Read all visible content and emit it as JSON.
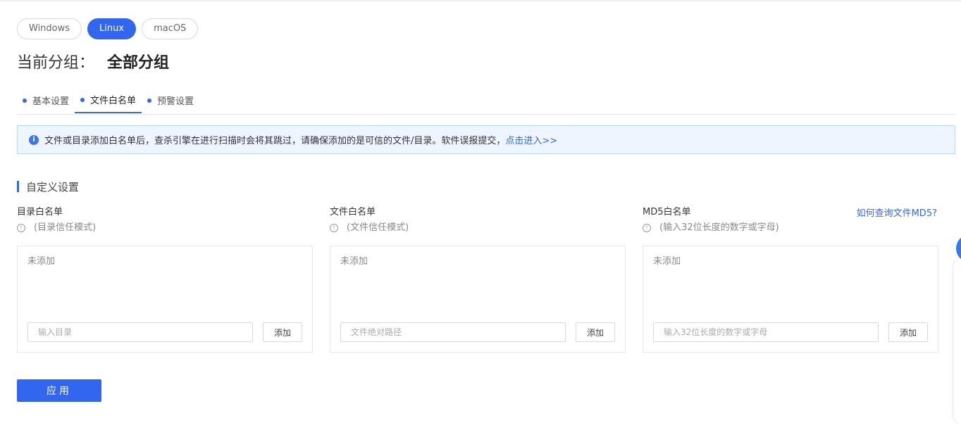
{
  "os_tabs": [
    {
      "label": "Windows",
      "active": false
    },
    {
      "label": "Linux",
      "active": true
    },
    {
      "label": "macOS",
      "active": false
    }
  ],
  "group": {
    "label": "当前分组：",
    "value": "全部分组"
  },
  "sub_tabs": [
    {
      "label": "基本设置",
      "active": false
    },
    {
      "label": "文件白名单",
      "active": true
    },
    {
      "label": "预警设置",
      "active": false
    }
  ],
  "notice": {
    "text": "文件或目录添加白名单后，查杀引擎在进行扫描时会将其跳过，请确保添加的是可信的文件/目录。软件误报提交，",
    "link": "点击进入>>"
  },
  "section": {
    "title": "自定义设置"
  },
  "columns": {
    "dir": {
      "title": "目录白名单",
      "subtitle": "(目录信任模式)",
      "empty": "未添加",
      "placeholder": "输入目录",
      "add_label": "添加"
    },
    "file": {
      "title": "文件白名单",
      "subtitle": "(文件信任模式)",
      "empty": "未添加",
      "placeholder": "文件绝对路径",
      "add_label": "添加"
    },
    "md5": {
      "title": "MD5白名单",
      "subtitle": "(输入32位长度的数字或字母)",
      "empty": "未添加",
      "placeholder": "输入32位长度的数字或字母",
      "add_label": "添加",
      "help_link": "如何查询文件MD5?"
    }
  },
  "apply_label": "应用",
  "colors": {
    "accent": "#3366ee",
    "notice_bg": "#eef5fe",
    "notice_border": "#b9d6f6"
  }
}
